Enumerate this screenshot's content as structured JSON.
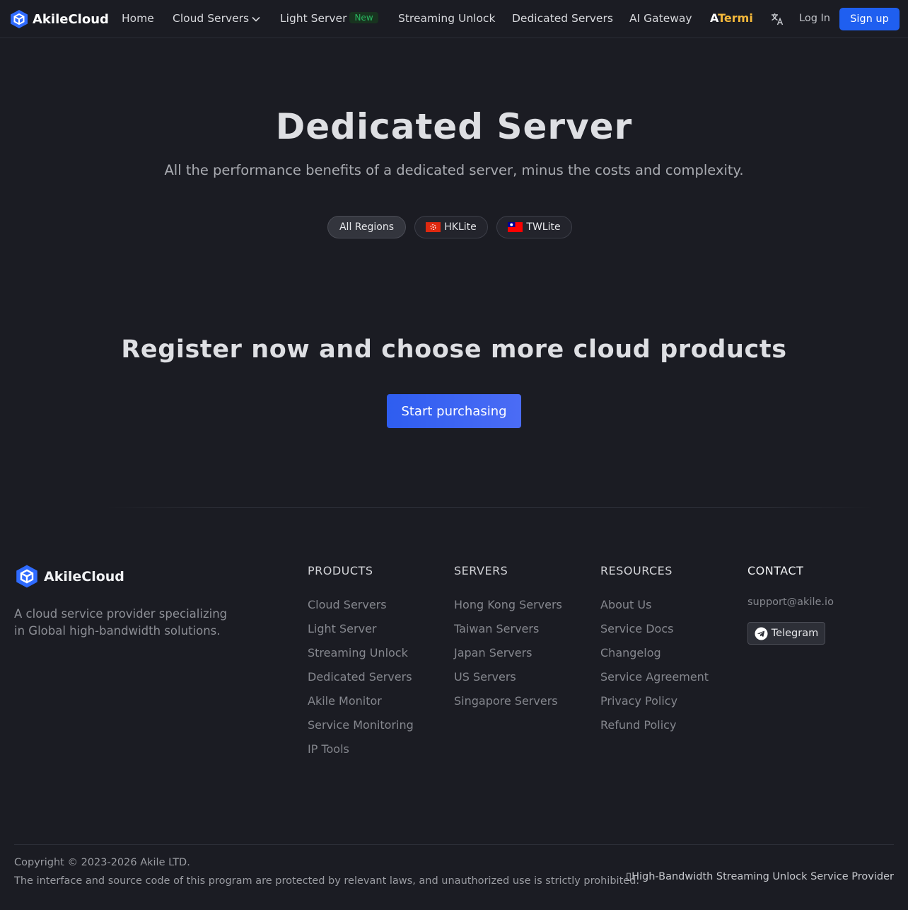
{
  "nav": {
    "brand": "AkileCloud",
    "links": {
      "home": "Home",
      "cloud_servers": "Cloud Servers",
      "light_server": "Light Server",
      "light_server_badge": "New",
      "streaming_unlock": "Streaming Unlock",
      "dedicated_servers": "Dedicated Servers",
      "ai_gateway": "AI Gateway"
    },
    "aterm": {
      "first": "A",
      "rest": "Termi"
    },
    "login": "Log In",
    "signup": "Sign up"
  },
  "hero": {
    "title": "Dedicated Server",
    "subtitle": "All the performance benefits of a dedicated server, minus the costs and complexity.",
    "filters": {
      "all": "All Regions",
      "hk": "HKLite",
      "tw": "TWLite"
    }
  },
  "cta": {
    "title": "Register now and choose more cloud products",
    "button": "Start purchasing"
  },
  "footer": {
    "brand": "AkileCloud",
    "description": "A cloud service provider specializing in Global high-bandwidth solutions.",
    "products": {
      "heading": "PRODUCTS",
      "items": [
        "Cloud Servers",
        "Light Server",
        "Streaming Unlock",
        "Dedicated Servers",
        "Akile Monitor",
        "Service Monitoring",
        "IP Tools"
      ]
    },
    "servers": {
      "heading": "SERVERS",
      "items": [
        "Hong Kong Servers",
        "Taiwan Servers",
        "Japan Servers",
        "US Servers",
        "Singapore Servers"
      ]
    },
    "resources": {
      "heading": "RESOURCES",
      "items": [
        "About Us",
        "Service Docs",
        "Changelog",
        "Service Agreement",
        "Privacy Policy",
        "Refund Policy"
      ]
    },
    "contact": {
      "heading": "CONTACT",
      "email": "support@akile.io",
      "telegram": "Telegram"
    },
    "copyright": "Copyright © 2023-2026 Akile LTD.",
    "legal": "The interface and source code of this program are protected by relevant laws, and unauthorized use is strictly prohibited.",
    "tagline": "High-Bandwidth Streaming Unlock Service Provider"
  },
  "colors": {
    "background": "#1b1c23",
    "accent": "#1f5ff0",
    "aterm_highlight": "#f5b93b",
    "badge_green": "#29b560"
  }
}
